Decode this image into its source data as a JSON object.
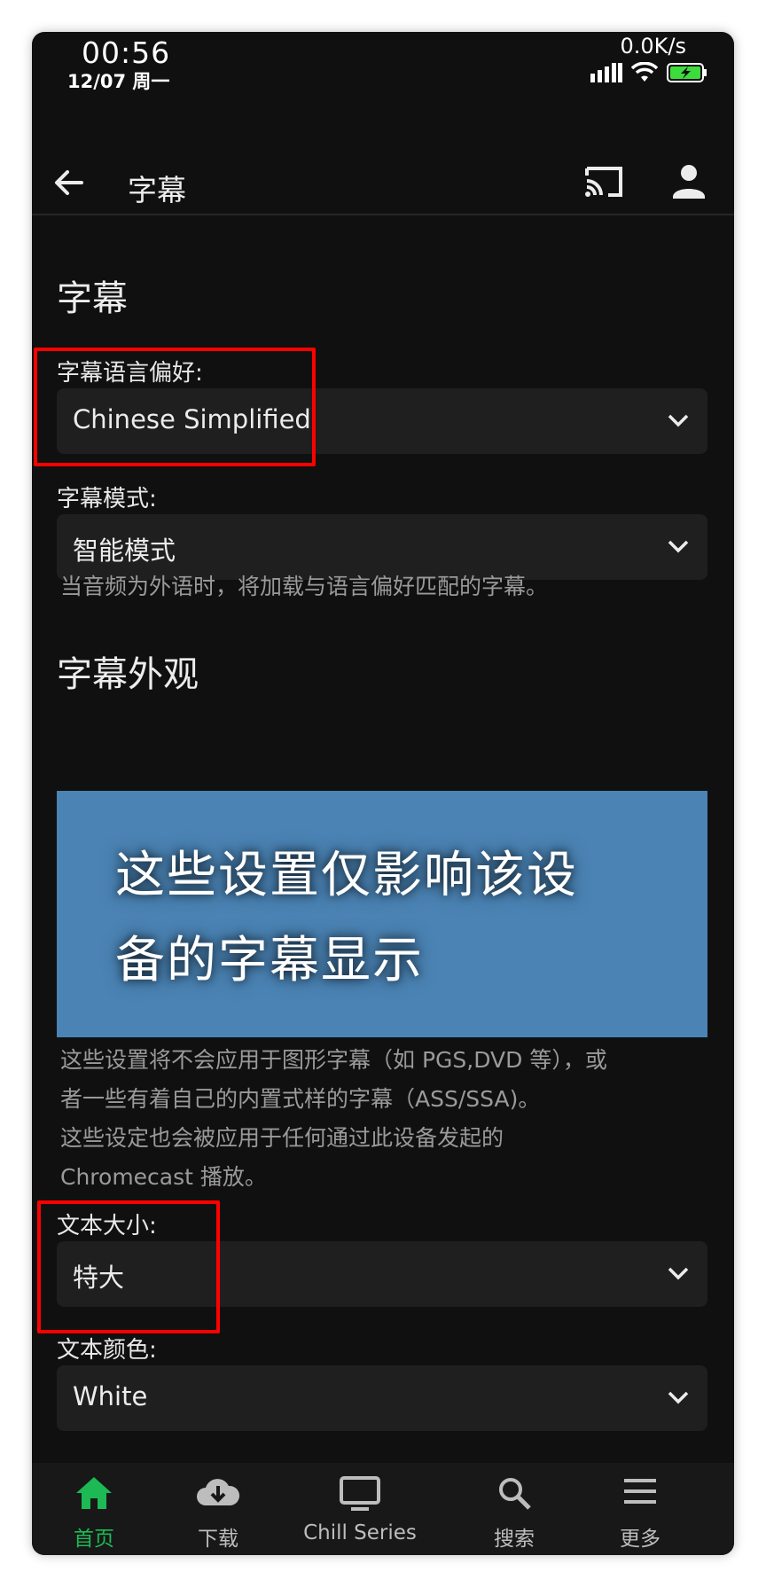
{
  "status": {
    "time": "00:56",
    "date": "12/07 周一",
    "speed": "0.0K/s"
  },
  "appbar": {
    "title": "字幕"
  },
  "subtitles_section": {
    "title": "字幕",
    "language_label": "字幕语言偏好:",
    "language_value": "Chinese Simplified",
    "mode_label": "字幕模式:",
    "mode_value": "智能模式",
    "mode_help": "当音频为外语时，将加载与语言偏好匹配的字幕。"
  },
  "appearance_section": {
    "title": "字幕外观",
    "preview_line1": "这些设置仅影响该设",
    "preview_line2": "备的字幕显示",
    "help_line1": "这些设置将不会应用于图形字幕（如 PGS,DVD 等），或",
    "help_line2": "者一些有着自己的内置式样的字幕（ASS/SSA)。",
    "help_line3": "这些设定也会被应用于任何通过此设备发起的",
    "help_line4": "Chromecast 播放。",
    "text_size_label": "文本大小:",
    "text_size_value": "特大",
    "text_color_label": "文本颜色:",
    "text_color_value": "White"
  },
  "bottom_nav": [
    {
      "label": "首页",
      "icon": "home-icon",
      "active": true
    },
    {
      "label": "下载",
      "icon": "download-icon",
      "active": false
    },
    {
      "label": "Chill Series",
      "icon": "tv-icon",
      "active": false
    },
    {
      "label": "搜索",
      "icon": "search-icon",
      "active": false
    },
    {
      "label": "更多",
      "icon": "menu-icon",
      "active": false
    }
  ],
  "colors": {
    "accent": "#1db954",
    "preview_bg": "#4a83b4",
    "annotation": "#ff0000"
  }
}
